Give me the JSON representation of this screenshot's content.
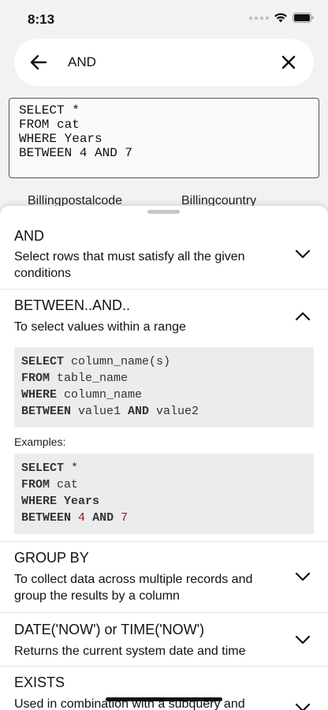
{
  "status": {
    "time": "8:13"
  },
  "search": {
    "query": "AND"
  },
  "editor": {
    "lines": [
      "SELECT *",
      "FROM cat",
      "WHERE Years",
      "BETWEEN 4 AND 7"
    ]
  },
  "columns": [
    "Billingpostalcode",
    "Billingcountry"
  ],
  "items": [
    {
      "title": "AND",
      "description": "Select rows that must satisfy all the given conditions",
      "expanded": false
    },
    {
      "title": "BETWEEN..AND..",
      "description": "To select values within a range",
      "expanded": true,
      "syntax": {
        "l1_kw": "SELECT",
        "l1_rest": " column_name(s)",
        "l2_kw": "FROM",
        "l2_rest": " table_name",
        "l3_kw": "WHERE",
        "l3_rest": " column_name",
        "l4_kw1": "BETWEEN",
        "l4_mid": " value1 ",
        "l4_kw2": "AND",
        "l4_rest": " value2"
      },
      "examples_label": "Examples:",
      "example": {
        "l1_kw": "SELECT",
        "l1_rest": " *",
        "l2_kw": "FROM",
        "l2_rest": " cat",
        "l3_kw": "WHERE",
        "l3_rest": " Years",
        "l4_kw1": "BETWEEN",
        "l4_num1": "4",
        "l4_kw2": "AND",
        "l4_num2": "7"
      }
    },
    {
      "title": "GROUP BY",
      "description": "To collect data across multiple records and group the results by a column",
      "expanded": false
    },
    {
      "title": "DATE('NOW') or TIME('NOW')",
      "description": "Returns the current system date and time",
      "expanded": false
    },
    {
      "title": "EXISTS",
      "description": "Used in combination with a subquery and",
      "expanded": false
    }
  ]
}
